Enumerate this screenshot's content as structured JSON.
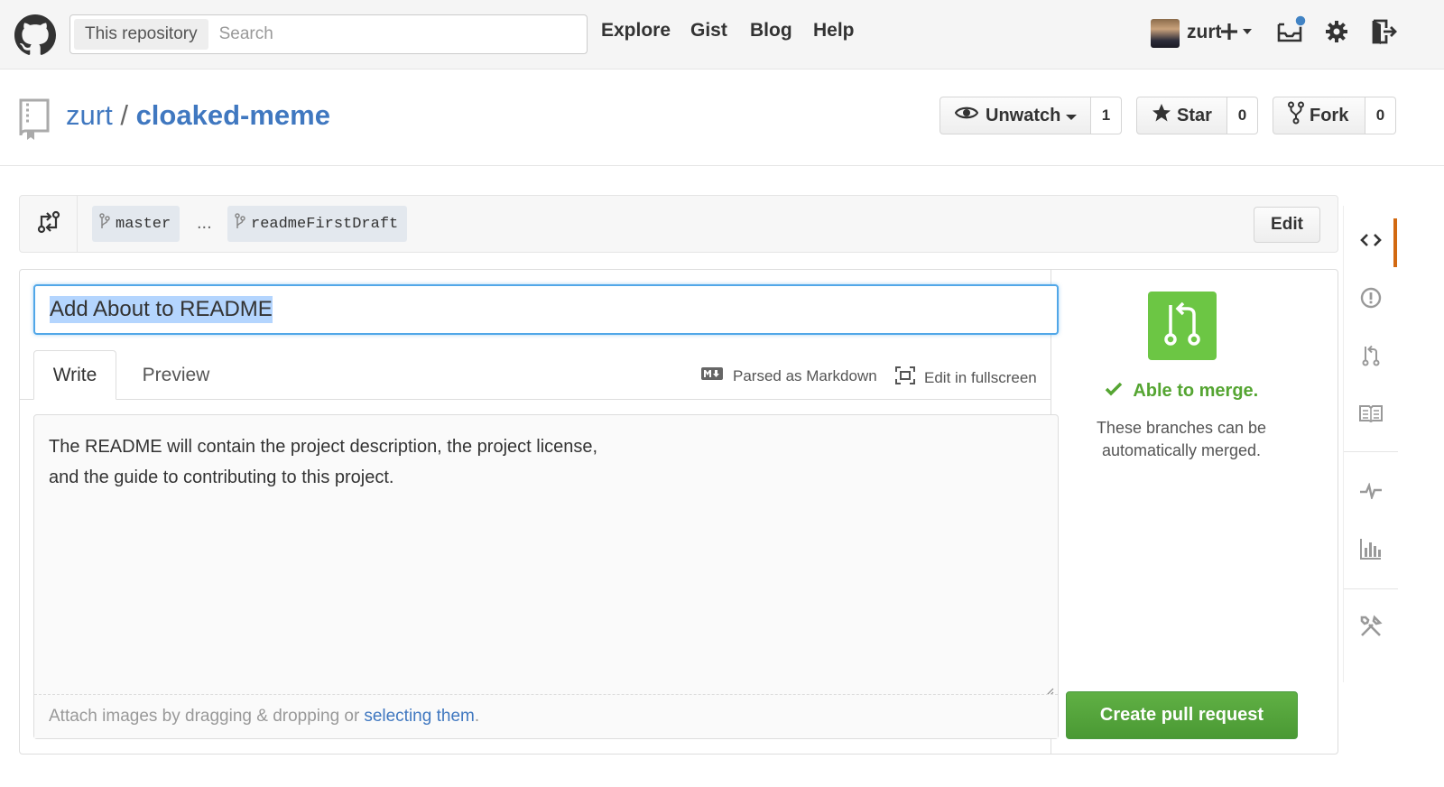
{
  "header": {
    "search_scope": "This repository",
    "search_placeholder": "Search",
    "nav": [
      "Explore",
      "Gist",
      "Blog",
      "Help"
    ],
    "username": "zurt",
    "icons": [
      "github-logo-icon",
      "plus-icon",
      "notifications-icon",
      "gear-icon",
      "sign-out-icon"
    ]
  },
  "repo": {
    "owner": "zurt",
    "separator": "/",
    "name": "cloaked-meme",
    "unwatch_label": "Unwatch",
    "watch_count": "1",
    "star_label": "Star",
    "star_count": "0",
    "fork_label": "Fork",
    "fork_count": "0"
  },
  "compare": {
    "base": "master",
    "ellipsis": "...",
    "head": "readmeFirstDraft",
    "edit_label": "Edit"
  },
  "pr": {
    "title": "Add About to README",
    "tabs": [
      "Write",
      "Preview"
    ],
    "markdown_note": "Parsed as Markdown",
    "fullscreen_label": "Edit in fullscreen",
    "body": "The README will contain the project description, the project license,\nand the guide to contributing to this project.",
    "attach_text": "Attach images by dragging & dropping or",
    "attach_link": "selecting them",
    "attach_end": "."
  },
  "merge": {
    "status": "Able to merge.",
    "description": "These branches can be automatically merged.",
    "button": "Create pull request",
    "color": "#6cc644"
  },
  "sidebar": {
    "items": [
      "code-icon",
      "issues-icon",
      "pull-requests-icon",
      "wiki-icon",
      "pulse-icon",
      "graphs-icon",
      "settings-icon"
    ],
    "active_color": "#d26911"
  }
}
